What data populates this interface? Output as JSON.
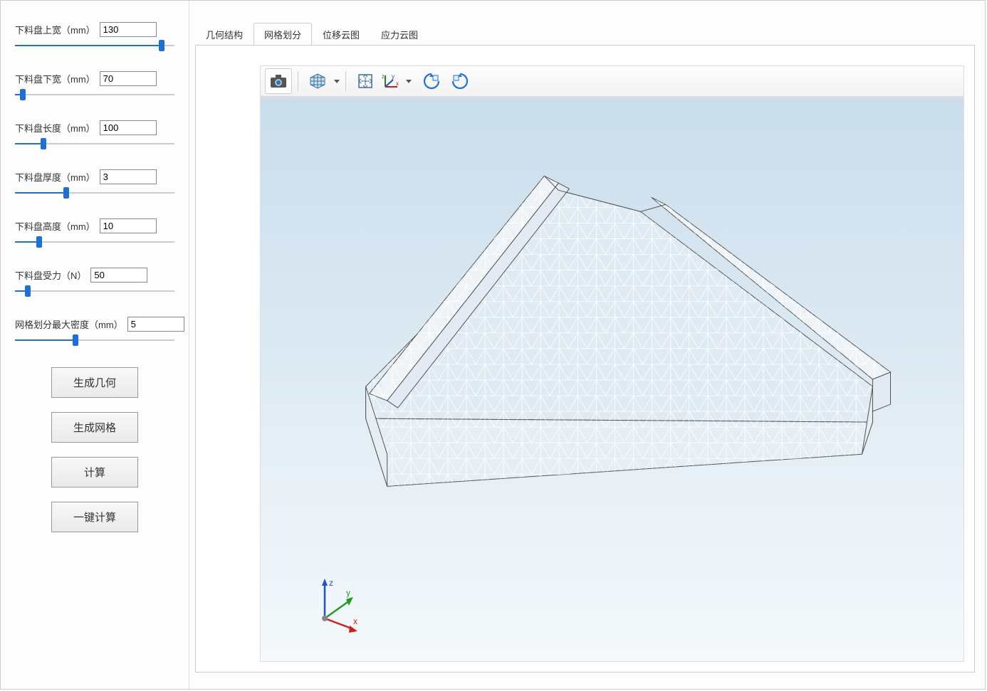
{
  "sidebar": {
    "params": [
      {
        "label": "下料盘上宽（mm）",
        "value": "130",
        "pct": 92
      },
      {
        "label": "下料盘下宽（mm）",
        "value": "70",
        "pct": 5
      },
      {
        "label": "下料盘长度（mm）",
        "value": "100",
        "pct": 18
      },
      {
        "label": "下料盘厚度（mm）",
        "value": "3",
        "pct": 32
      },
      {
        "label": "下料盘高度（mm）",
        "value": "10",
        "pct": 15
      },
      {
        "label": "下料盘受力（N）",
        "value": "50",
        "pct": 8
      },
      {
        "label": "网格划分最大密度（mm）",
        "value": "5",
        "pct": 38
      }
    ],
    "buttons": {
      "geometry": "生成几何",
      "mesh": "生成网格",
      "compute": "计算",
      "one_click": "一键计算"
    }
  },
  "tabs": [
    {
      "id": "geometry",
      "label": "几何结构",
      "active": false
    },
    {
      "id": "mesh",
      "label": "网格划分",
      "active": true
    },
    {
      "id": "displacement",
      "label": "位移云图",
      "active": false
    },
    {
      "id": "stress",
      "label": "应力云图",
      "active": false
    }
  ],
  "toolbar_icons": {
    "camera": "camera-icon",
    "cube": "cube-view-icon",
    "extents": "zoom-extents-icon",
    "axes": "axes-orientation-icon",
    "rotate_ccw": "rotate-ccw-icon",
    "rotate_cw": "rotate-cw-icon"
  },
  "viewer": {
    "triad_labels": {
      "x": "x",
      "y": "y",
      "z": "z"
    },
    "model_description": "trapezoidal tray with side flanges, triangular FE mesh wireframe"
  },
  "colors": {
    "slider_fill": "#1e6fd9",
    "viewport_top": "#c9ddec",
    "viewport_bottom": "#f5f9fb"
  }
}
